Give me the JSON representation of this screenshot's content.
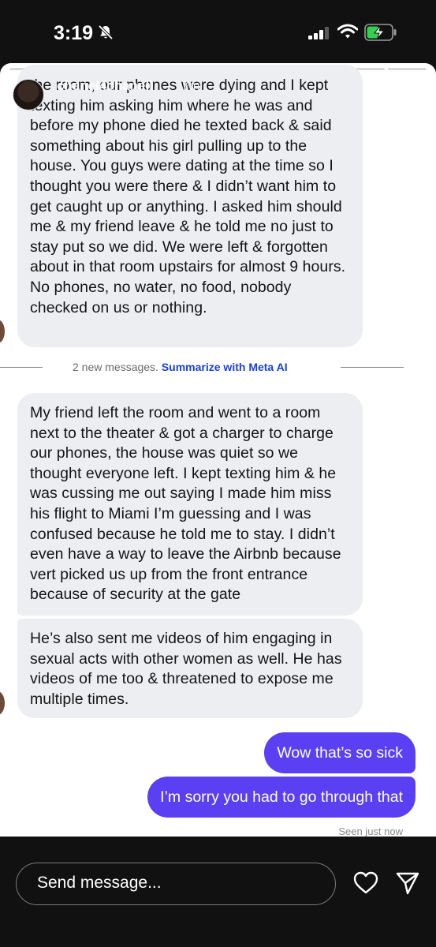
{
  "status_bar": {
    "time": "3:19"
  },
  "story": {
    "username": "chanel4chanell",
    "time_ago": "7m"
  },
  "messages": {
    "incoming_1": "the room, our phones were dying and I kept texting him asking him where he was and before my phone died he texted back & said something about his girl pulling up to the house. You guys were dating at the time so I thought you were there & I didn’t want him to get caught up or anything. I asked him should me & my friend leave & he told me no just to stay put so we did. We were left & forgotten about in that room upstairs for almost 9 hours. No phones, no water, no food, nobody checked on us or nothing.",
    "new_messages_label": "2 new messages.",
    "summarize_label": "Summarize with Meta AI",
    "incoming_2": "My friend left the room and went to a room next to the theater & got a charger to charge our phones, the house was quiet so we thought everyone left. I kept texting him & he was cussing me out saying I made him miss his flight to Miami I’m guessing and I was confused because he told me to stay. I didn’t even have a way to leave the Airbnb because vert picked us up from the front entrance because of security at the gate",
    "incoming_3": "He’s also sent me videos of him engaging in sexual acts with other women as well. He has videos of me too & threatened to expose me multiple times.",
    "outgoing_1": "Wow that’s so sick",
    "outgoing_2": "I’m sorry you had to go through that",
    "seen": "Seen just now"
  },
  "footer": {
    "send_placeholder": "Send message..."
  },
  "colors": {
    "outgoing_bubble": "#5b3ff2",
    "incoming_bubble": "#eceef2",
    "link": "#1a3fd6"
  },
  "icons": [
    "bell-slash-icon",
    "signal-icon",
    "wifi-icon",
    "battery-charging-icon",
    "more-icon",
    "close-icon",
    "heart-icon",
    "share-icon"
  ]
}
